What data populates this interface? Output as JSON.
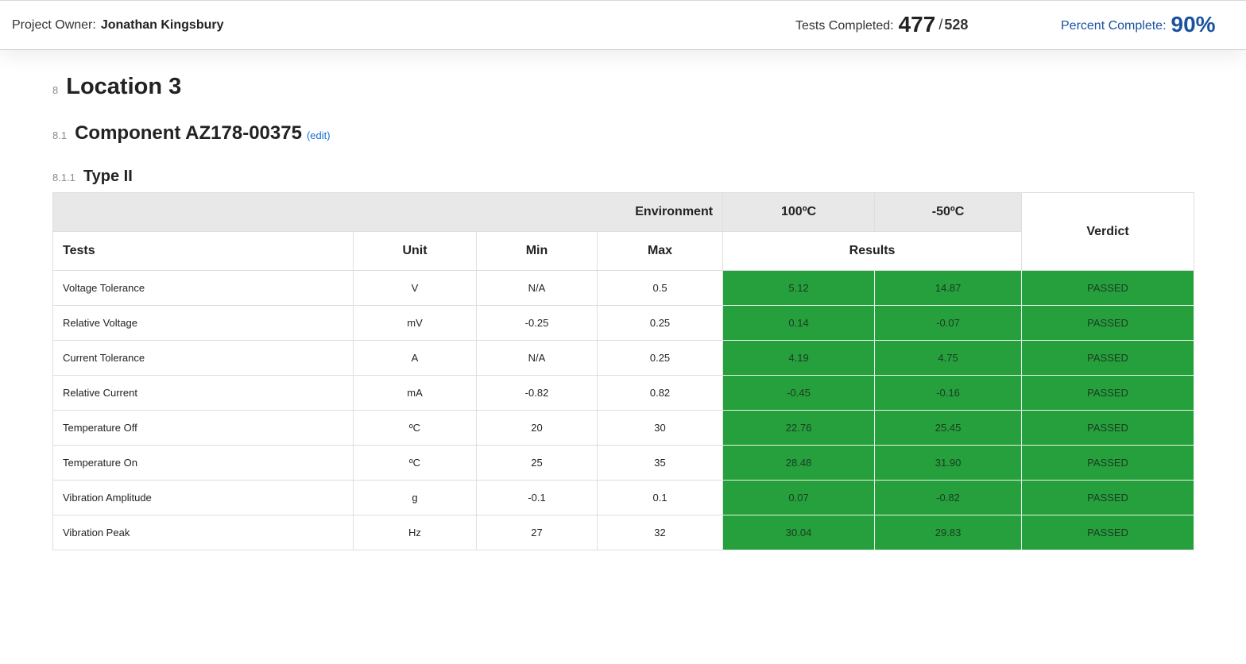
{
  "header": {
    "owner_label": "Project Owner:",
    "owner_name": "Jonathan Kingsbury",
    "tests_label": "Tests Completed:",
    "tests_done": "477",
    "tests_total": "528",
    "percent_label": "Percent Complete:",
    "percent_value": "90%"
  },
  "colors": {
    "accent_blue": "#1a52a0",
    "link_blue": "#1a6fd1",
    "pass_green": "#25a03c",
    "header_gray": "#e8e8e8"
  },
  "sections": {
    "location": {
      "num": "8",
      "title": "Location 3"
    },
    "component": {
      "num": "8.1",
      "title": "Component AZ178-00375",
      "edit_label": "(edit)"
    },
    "type": {
      "num": "8.1.1",
      "title": "Type II"
    }
  },
  "table": {
    "environment_label": "Environment",
    "env_temps": [
      "100ºC",
      "-50ºC"
    ],
    "verdict_label": "Verdict",
    "headers": {
      "tests": "Tests",
      "unit": "Unit",
      "min": "Min",
      "max": "Max",
      "results": "Results"
    },
    "rows": [
      {
        "test": "Voltage Tolerance",
        "unit": "V",
        "min": "N/A",
        "max": "0.5",
        "r1": "5.12",
        "r2": "14.87",
        "verdict": "PASSED"
      },
      {
        "test": "Relative Voltage",
        "unit": "mV",
        "min": "-0.25",
        "max": "0.25",
        "r1": "0.14",
        "r2": "-0.07",
        "verdict": "PASSED"
      },
      {
        "test": "Current Tolerance",
        "unit": "A",
        "min": "N/A",
        "max": "0.25",
        "r1": "4.19",
        "r2": "4.75",
        "verdict": "PASSED"
      },
      {
        "test": "Relative Current",
        "unit": "mA",
        "min": "-0.82",
        "max": "0.82",
        "r1": "-0.45",
        "r2": "-0.16",
        "verdict": "PASSED"
      },
      {
        "test": "Temperature Off",
        "unit": "ºC",
        "min": "20",
        "max": "30",
        "r1": "22.76",
        "r2": "25.45",
        "verdict": "PASSED"
      },
      {
        "test": "Temperature On",
        "unit": "ºC",
        "min": "25",
        "max": "35",
        "r1": "28.48",
        "r2": "31.90",
        "verdict": "PASSED"
      },
      {
        "test": "Vibration Amplitude",
        "unit": "g",
        "min": "-0.1",
        "max": "0.1",
        "r1": "0.07",
        "r2": "-0.82",
        "verdict": "PASSED"
      },
      {
        "test": "Vibration Peak",
        "unit": "Hz",
        "min": "27",
        "max": "32",
        "r1": "30.04",
        "r2": "29.83",
        "verdict": "PASSED"
      }
    ]
  }
}
